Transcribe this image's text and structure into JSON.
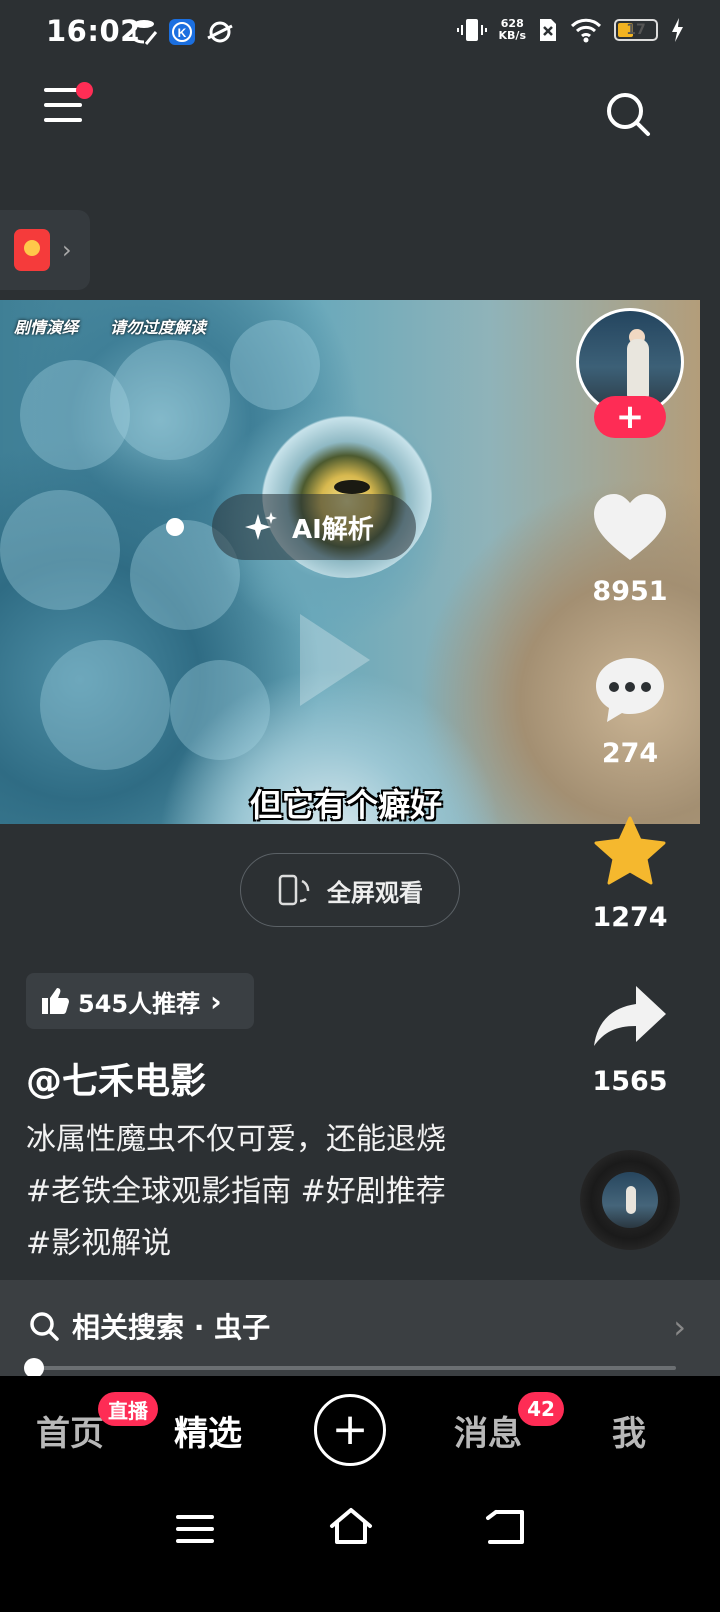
{
  "status_bar": {
    "time": "16:02",
    "net_speed_value": "628",
    "net_speed_unit": "KB/s",
    "battery_level": "17",
    "battery_color": "#f2b321"
  },
  "top_bar": {
    "menu_icon": "hamburger-menu-icon",
    "search_icon": "search-icon"
  },
  "video": {
    "tag_left": "剧情演绎",
    "tag_right": "请勿过度解读",
    "ai_label": "AI解析",
    "subtitle": "但它有个癖好"
  },
  "actions": {
    "likes": "8951",
    "comments": "274",
    "favorites": "1274",
    "shares": "1565",
    "follow_symbol": "+"
  },
  "fullscreen": {
    "label": "全屏观看"
  },
  "post": {
    "recommend_label": "545人推荐",
    "author": "@七禾电影",
    "description": "冰属性魔虫不仅可爱，还能退烧 #老铁全球观影指南 #好剧推荐 #影视解说"
  },
  "related_search": {
    "label": "相关搜索 · 虫子"
  },
  "playback": {
    "progress_fraction": 0.01
  },
  "bottom_nav": {
    "home": "首页",
    "live_badge": "直播",
    "featured": "精选",
    "add_symbol": "+",
    "messages": "消息",
    "messages_badge": "42",
    "me": "我"
  },
  "colors": {
    "accent": "#fe2c55",
    "star": "#f5b82e",
    "background": "#2c3033"
  }
}
